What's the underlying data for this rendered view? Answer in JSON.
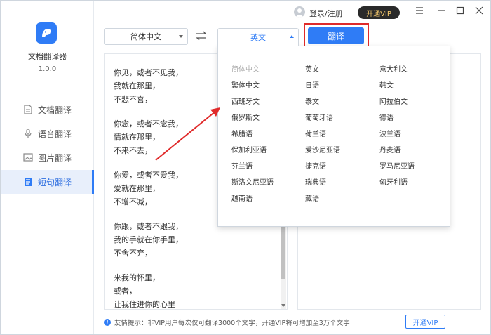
{
  "app": {
    "name": "文档翻译器",
    "version": "1.0.0"
  },
  "nav": [
    {
      "label": "文档翻译",
      "icon": "document-icon",
      "active": false
    },
    {
      "label": "语音翻译",
      "icon": "microphone-icon",
      "active": false
    },
    {
      "label": "图片翻译",
      "icon": "image-icon",
      "active": false
    },
    {
      "label": "短句翻译",
      "icon": "text-file-icon",
      "active": true
    }
  ],
  "titlebar": {
    "login": "登录/注册",
    "vip": "开通VIP"
  },
  "toolbar": {
    "source_lang": "简体中文",
    "target_lang": "英文",
    "translate": "翻译"
  },
  "source_text": {
    "lines": [
      "你见，或者不见我，",
      "我就在那里，",
      "不悲不喜，",
      "",
      "你念，或者不念我，",
      "情就在那里，",
      "不来不去，",
      "",
      "你爱，或者不爱我，",
      "爱就在那里，",
      "不增不减，",
      "",
      "你跟，或者不跟我，",
      "我的手就在你手里，",
      "不舍不弃，",
      "",
      "来我的怀里，",
      "或者，",
      "让我住进你的心里"
    ]
  },
  "dropdown": {
    "columns": [
      [
        "简体中文",
        "繁体中文",
        "西班牙文",
        "俄罗斯文",
        "希腊语",
        "保加利亚语",
        "芬兰语",
        "斯洛文尼亚语",
        "越南语"
      ],
      [
        "英文",
        "日语",
        "泰文",
        "葡萄牙语",
        "荷兰语",
        "爱沙尼亚语",
        "捷克语",
        "瑞典语",
        "藏语"
      ],
      [
        "意大利文",
        "韩文",
        "阿拉伯文",
        "德语",
        "波兰语",
        "丹麦语",
        "罗马尼亚语",
        "匈牙利语"
      ]
    ],
    "disabled": "简体中文"
  },
  "footer": {
    "tip": "友情提示：非VIP用户每次仅可翻译3000个文字，开通VIP将可增加至3万个文字",
    "vip_button": "开通VIP"
  },
  "colors": {
    "accent": "#2f7cf6",
    "highlight": "#e02a2a",
    "vip_bg": "#2a2a2a",
    "vip_text": "#f5c86b"
  }
}
